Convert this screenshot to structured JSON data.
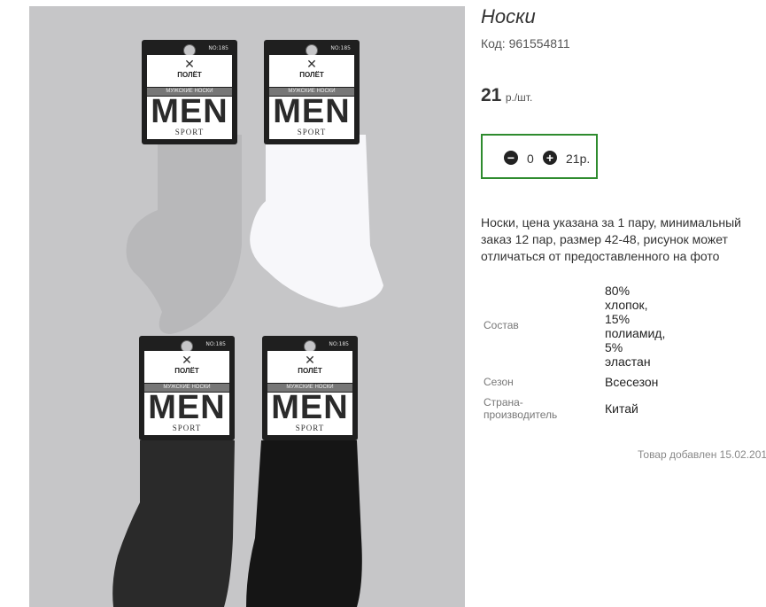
{
  "product": {
    "title": "Носки",
    "code": "Код: 961554811",
    "price_value": "21",
    "price_unit": "р./шт.",
    "description": "Носки, цена указана за 1 пару, минимальный заказ 12 пар, размер 42-48, рисунок может отличаться от предоставленного на фото"
  },
  "cart": {
    "minus_icon": "minus-circle-icon",
    "plus_icon": "plus-circle-icon",
    "quantity": "0",
    "sum": "21р."
  },
  "properties": [
    {
      "key": "Состав",
      "value_lines": [
        "80%",
        "хлопок,",
        "15%",
        "полиамид,",
        "5%",
        "эластан"
      ]
    },
    {
      "key": "Сезон",
      "value": "Всесезон"
    },
    {
      "key_lines": [
        "Страна-",
        "производитель"
      ],
      "value": "Китай"
    }
  ],
  "added_text": "Товар добавлен 15.02.201",
  "photo": {
    "tag_brand": "ПОЛЁТ",
    "tag_strip": "МУЖСКИЕ НОСКИ",
    "tag_no": "NO:185",
    "tag_men": "MEN",
    "tag_sport": "SPORT",
    "sock_colors": [
      "#b8b8ba",
      "#f7f7fa",
      "#222222",
      "#111111"
    ]
  },
  "colors": {
    "cart_border": "#2e8b2e",
    "photo_bg": "#c6c6c8"
  }
}
